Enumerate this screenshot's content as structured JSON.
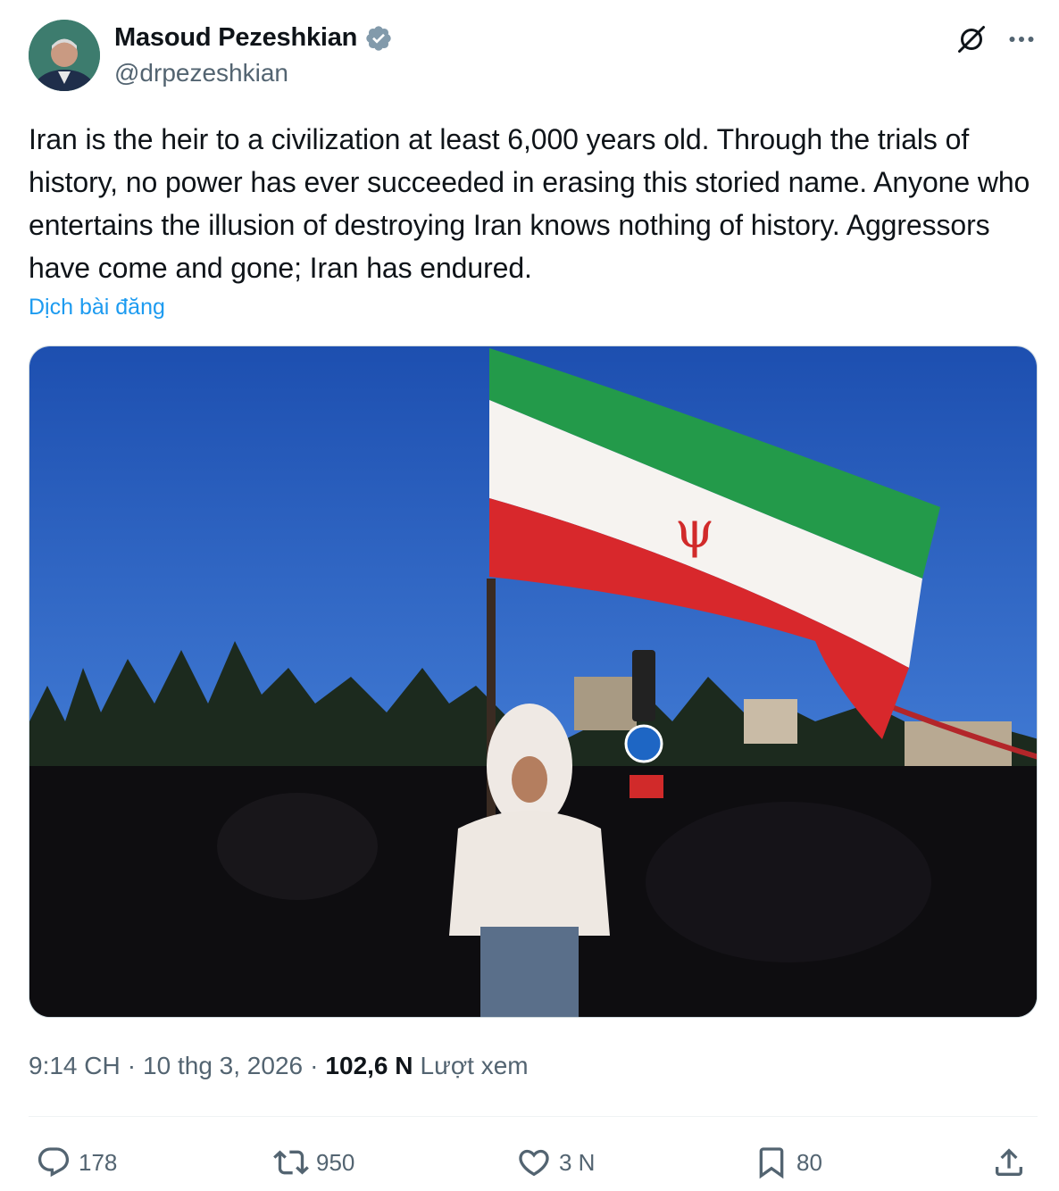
{
  "author": {
    "name": "Masoud Pezeshkian",
    "handle": "@drpezeshkian",
    "verified": true,
    "verified_color": "#829aab"
  },
  "header_icons": [
    "grok-icon",
    "more-icon"
  ],
  "tweet": {
    "text": "Iran is the heir to a civilization at least 6,000 years old. Through the trials of history, no power has ever succeeded in erasing this storied name. Anyone who entertains the illusion of destroying Iran knows nothing of history. Aggressors have come and gone; Iran has endured.",
    "translate_label": "Dịch bài đăng"
  },
  "meta": {
    "time": "9:14 CH",
    "date": "10 thg 3, 2026",
    "views_count": "102,6 N",
    "views_label": "Lượt xem"
  },
  "actions": {
    "reply_count": "178",
    "repost_count": "950",
    "like_count": "3 N",
    "bookmark_count": "80"
  },
  "colors": {
    "link": "#1d9bf0",
    "secondary_text": "#536471",
    "primary_text": "#0f1419"
  }
}
